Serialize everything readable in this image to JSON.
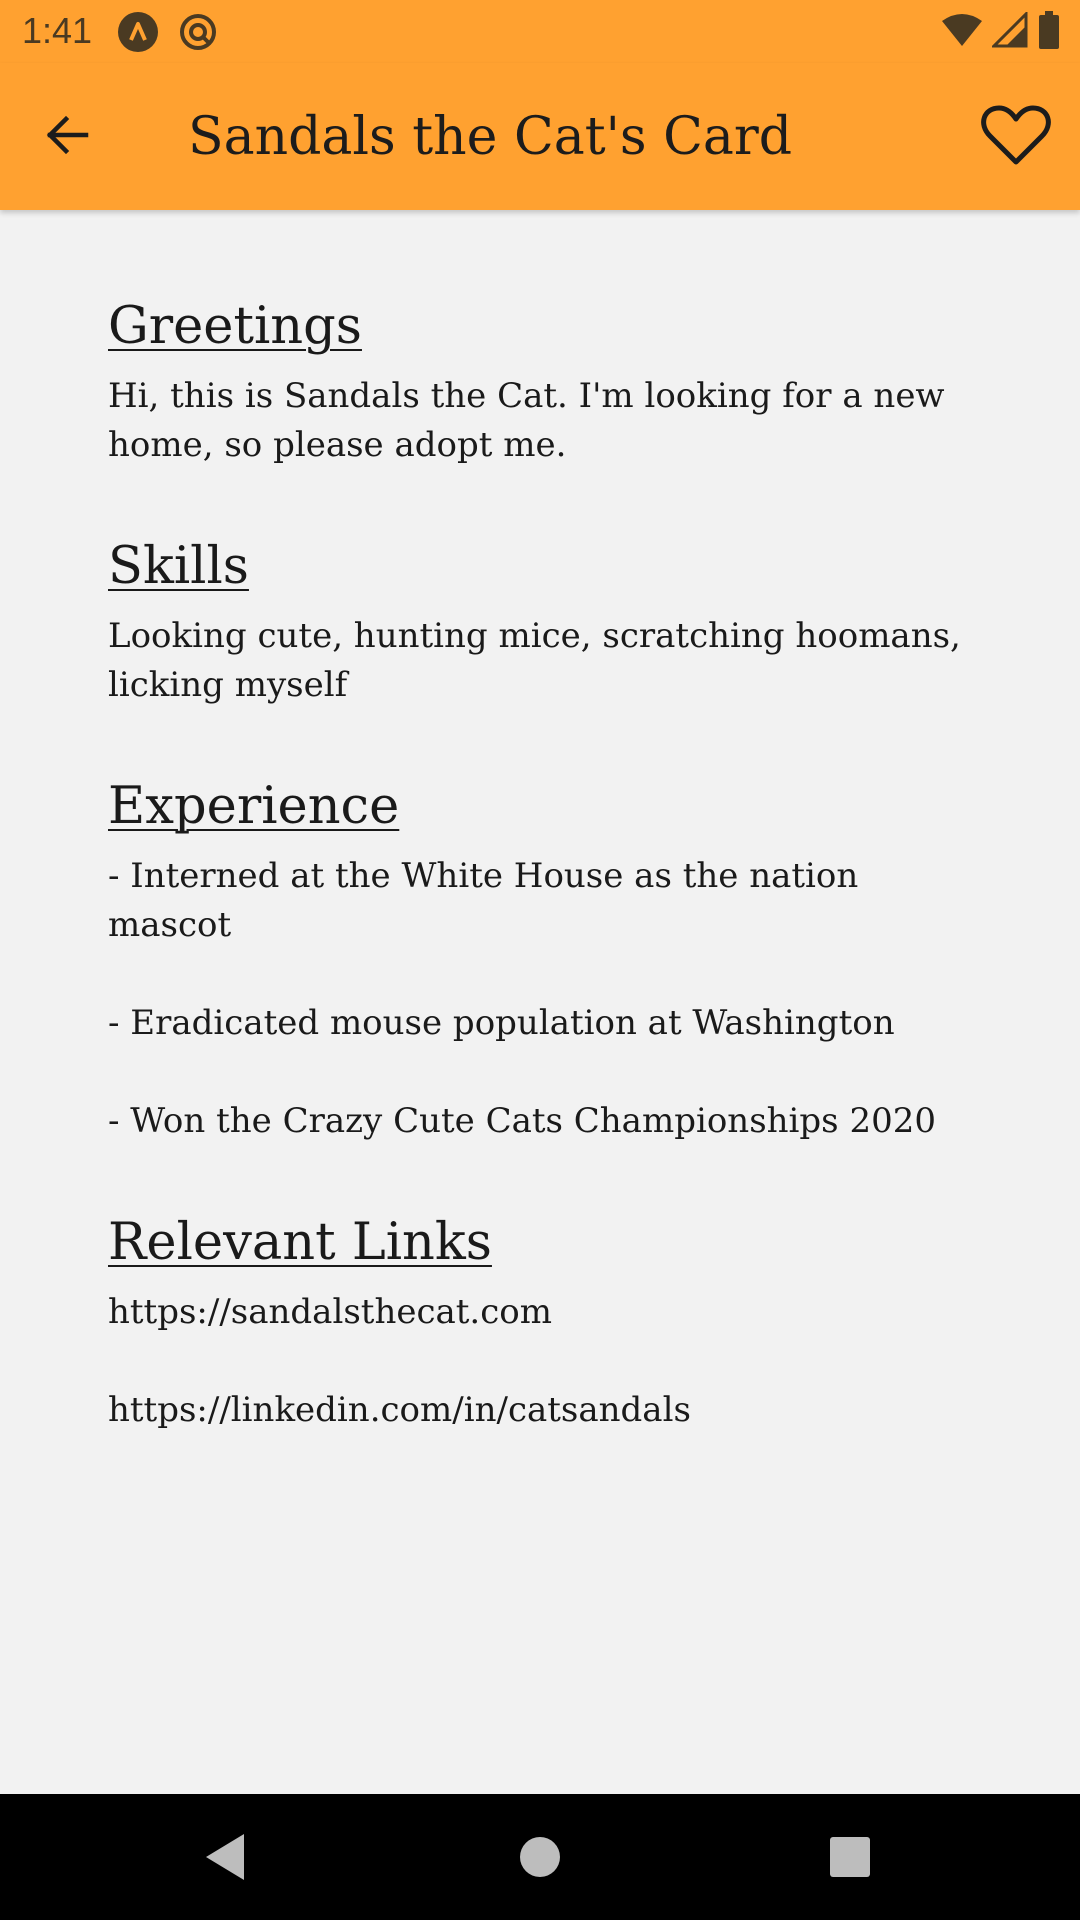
{
  "status_bar": {
    "time": "1:41"
  },
  "app_bar": {
    "title": "Sandals the Cat's Card"
  },
  "sections": {
    "greetings": {
      "title": "Greetings",
      "text": "Hi, this is Sandals the Cat. I'm looking for a new home, so please adopt me."
    },
    "skills": {
      "title": "Skills",
      "text": "Looking cute, hunting mice, scratching hoomans, licking myself"
    },
    "experience": {
      "title": "Experience",
      "items": [
        "- Interned at the White House as the nation mascot",
        "- Eradicated mouse population at Washington",
        "- Won the Crazy Cute Cats Championships 2020"
      ]
    },
    "links": {
      "title": "Relevant Links",
      "items": [
        "https://sandalsthecat.com",
        "https://linkedin.com/in/catsandals"
      ]
    }
  },
  "colors": {
    "accent": "#ffa130",
    "background": "#f2f2f2",
    "nav_bar": "#000000"
  },
  "icons": {
    "back": "arrow-back-icon",
    "favorite": "heart-outline-icon",
    "nav_back": "triangle-back-icon",
    "nav_home": "circle-home-icon",
    "nav_recents": "square-recents-icon"
  }
}
